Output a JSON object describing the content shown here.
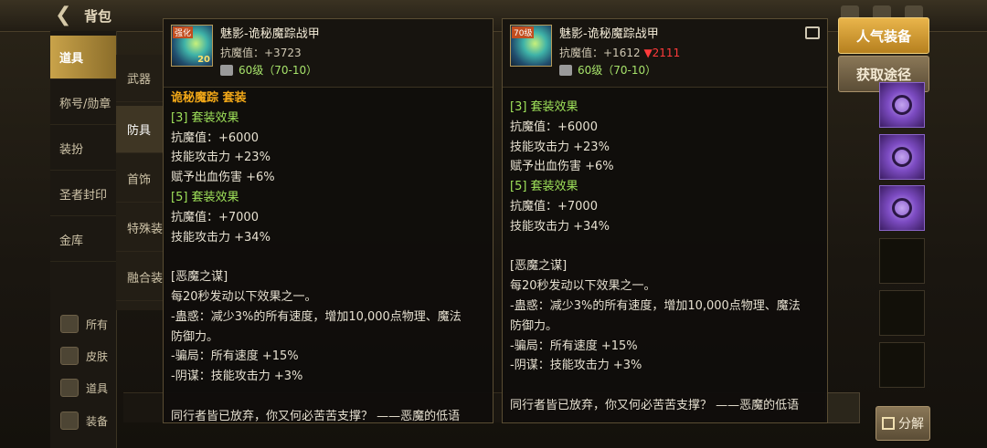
{
  "topbar": {
    "title": "背包",
    "back_icon": "back-arrow-icon"
  },
  "sidebar": {
    "items": [
      {
        "label": "道具",
        "active": true
      },
      {
        "label": "称号/勋章",
        "active": false
      },
      {
        "label": "装扮",
        "active": false
      },
      {
        "label": "圣者封印",
        "active": false
      },
      {
        "label": "金库",
        "active": false
      }
    ],
    "filters": [
      {
        "label": "所有",
        "icon": "diamond-icon"
      },
      {
        "label": "皮肤",
        "icon": "diamond-icon"
      },
      {
        "label": "道具",
        "icon": "pencil-icon"
      },
      {
        "label": "装备",
        "icon": "chef-icon"
      }
    ]
  },
  "categories": [
    {
      "label": "武器",
      "active": false
    },
    {
      "label": "防具",
      "active": true
    },
    {
      "label": "首饰",
      "active": false
    },
    {
      "label": "特殊装",
      "active": false
    },
    {
      "label": "融合装",
      "active": false
    }
  ],
  "left_panel": {
    "name": "魅影-诡秘魔踪战甲",
    "stat": "抗魔值：+3723",
    "level": "60级（70-10）",
    "thumb_level": "20",
    "thumb_tag": "强化",
    "set_name": "诡秘魔踪 套装",
    "lines": [
      {
        "text": "[3] 套装效果",
        "cls": "green"
      },
      {
        "text": "抗魔值：+6000",
        "cls": "white"
      },
      {
        "text": "技能攻击力 +23%",
        "cls": "white"
      },
      {
        "text": "赋予出血伤害 +6%",
        "cls": "white"
      },
      {
        "text": "[5] 套装效果",
        "cls": "green"
      },
      {
        "text": "抗魔值：+7000",
        "cls": "white"
      },
      {
        "text": "技能攻击力 +34%",
        "cls": "white"
      },
      {
        "text": "",
        "cls": "blank"
      },
      {
        "text": "[恶魔之谋]",
        "cls": "white"
      },
      {
        "text": "每20秒发动以下效果之一。",
        "cls": "white"
      },
      {
        "text": "-蛊惑：减少3%的所有速度，增加10,000点物理、魔法",
        "cls": "white"
      },
      {
        "text": "防御力。",
        "cls": "white"
      },
      {
        "text": "-骗局：所有速度 +15%",
        "cls": "white"
      },
      {
        "text": "-阴谋：技能攻击力 +3%",
        "cls": "white"
      },
      {
        "text": "",
        "cls": "blank"
      },
      {
        "text": "同行者皆已放弃，你又何必苦苦支撑？ ——恶魔的低语",
        "cls": "white"
      }
    ]
  },
  "right_panel": {
    "name": "魅影-诡秘魔踪战甲",
    "stat": "抗魔值：+1612",
    "stat_delta": "▼2111",
    "level": "60级（70-10）",
    "thumb_tag": "70级",
    "lines": [
      {
        "text": "[3] 套装效果",
        "cls": "green"
      },
      {
        "text": "抗魔值：+6000",
        "cls": "white"
      },
      {
        "text": "技能攻击力 +23%",
        "cls": "white"
      },
      {
        "text": "赋予出血伤害 +6%",
        "cls": "white"
      },
      {
        "text": "[5] 套装效果",
        "cls": "green"
      },
      {
        "text": "抗魔值：+7000",
        "cls": "white"
      },
      {
        "text": "技能攻击力 +34%",
        "cls": "white"
      },
      {
        "text": "",
        "cls": "blank"
      },
      {
        "text": "[恶魔之谋]",
        "cls": "white"
      },
      {
        "text": "每20秒发动以下效果之一。",
        "cls": "white"
      },
      {
        "text": "-蛊惑：减少3%的所有速度，增加10,000点物理、魔法",
        "cls": "white"
      },
      {
        "text": "防御力。",
        "cls": "white"
      },
      {
        "text": "-骗局：所有速度 +15%",
        "cls": "white"
      },
      {
        "text": "-阴谋：技能攻击力 +3%",
        "cls": "white"
      },
      {
        "text": "",
        "cls": "blank"
      },
      {
        "text": "同行者皆已放弃，你又何必苦苦支撑？ ——恶魔的低语",
        "cls": "white"
      }
    ]
  },
  "buttons": {
    "popular": "人气装备",
    "obtain": "获取途径",
    "decompose": "分解"
  },
  "colors": {
    "set_name": "#f2a818",
    "set_effect": "#9fe25a",
    "stat_down": "#ff3b3b",
    "level": "#a6e26a",
    "accent": "#c9a34a"
  }
}
